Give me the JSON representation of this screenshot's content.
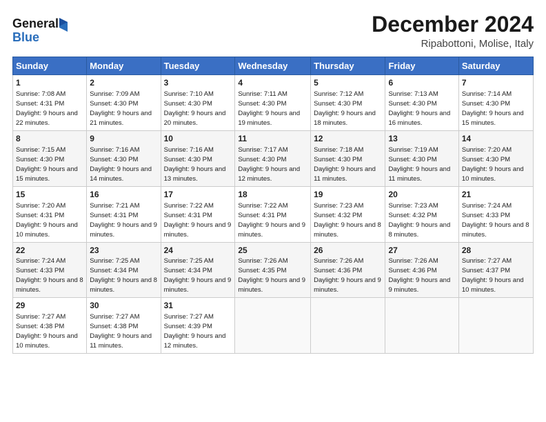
{
  "logo": {
    "line1": "General",
    "line2": "Blue"
  },
  "header": {
    "month": "December 2024",
    "location": "Ripabottoni, Molise, Italy"
  },
  "weekdays": [
    "Sunday",
    "Monday",
    "Tuesday",
    "Wednesday",
    "Thursday",
    "Friday",
    "Saturday"
  ],
  "weeks": [
    [
      {
        "day": "1",
        "sunrise": "7:08 AM",
        "sunset": "4:31 PM",
        "daylight": "9 hours and 22 minutes."
      },
      {
        "day": "2",
        "sunrise": "7:09 AM",
        "sunset": "4:30 PM",
        "daylight": "9 hours and 21 minutes."
      },
      {
        "day": "3",
        "sunrise": "7:10 AM",
        "sunset": "4:30 PM",
        "daylight": "9 hours and 20 minutes."
      },
      {
        "day": "4",
        "sunrise": "7:11 AM",
        "sunset": "4:30 PM",
        "daylight": "9 hours and 19 minutes."
      },
      {
        "day": "5",
        "sunrise": "7:12 AM",
        "sunset": "4:30 PM",
        "daylight": "9 hours and 18 minutes."
      },
      {
        "day": "6",
        "sunrise": "7:13 AM",
        "sunset": "4:30 PM",
        "daylight": "9 hours and 16 minutes."
      },
      {
        "day": "7",
        "sunrise": "7:14 AM",
        "sunset": "4:30 PM",
        "daylight": "9 hours and 15 minutes."
      }
    ],
    [
      {
        "day": "8",
        "sunrise": "7:15 AM",
        "sunset": "4:30 PM",
        "daylight": "9 hours and 15 minutes."
      },
      {
        "day": "9",
        "sunrise": "7:16 AM",
        "sunset": "4:30 PM",
        "daylight": "9 hours and 14 minutes."
      },
      {
        "day": "10",
        "sunrise": "7:16 AM",
        "sunset": "4:30 PM",
        "daylight": "9 hours and 13 minutes."
      },
      {
        "day": "11",
        "sunrise": "7:17 AM",
        "sunset": "4:30 PM",
        "daylight": "9 hours and 12 minutes."
      },
      {
        "day": "12",
        "sunrise": "7:18 AM",
        "sunset": "4:30 PM",
        "daylight": "9 hours and 11 minutes."
      },
      {
        "day": "13",
        "sunrise": "7:19 AM",
        "sunset": "4:30 PM",
        "daylight": "9 hours and 11 minutes."
      },
      {
        "day": "14",
        "sunrise": "7:20 AM",
        "sunset": "4:30 PM",
        "daylight": "9 hours and 10 minutes."
      }
    ],
    [
      {
        "day": "15",
        "sunrise": "7:20 AM",
        "sunset": "4:31 PM",
        "daylight": "9 hours and 10 minutes."
      },
      {
        "day": "16",
        "sunrise": "7:21 AM",
        "sunset": "4:31 PM",
        "daylight": "9 hours and 9 minutes."
      },
      {
        "day": "17",
        "sunrise": "7:22 AM",
        "sunset": "4:31 PM",
        "daylight": "9 hours and 9 minutes."
      },
      {
        "day": "18",
        "sunrise": "7:22 AM",
        "sunset": "4:31 PM",
        "daylight": "9 hours and 9 minutes."
      },
      {
        "day": "19",
        "sunrise": "7:23 AM",
        "sunset": "4:32 PM",
        "daylight": "9 hours and 8 minutes."
      },
      {
        "day": "20",
        "sunrise": "7:23 AM",
        "sunset": "4:32 PM",
        "daylight": "9 hours and 8 minutes."
      },
      {
        "day": "21",
        "sunrise": "7:24 AM",
        "sunset": "4:33 PM",
        "daylight": "9 hours and 8 minutes."
      }
    ],
    [
      {
        "day": "22",
        "sunrise": "7:24 AM",
        "sunset": "4:33 PM",
        "daylight": "9 hours and 8 minutes."
      },
      {
        "day": "23",
        "sunrise": "7:25 AM",
        "sunset": "4:34 PM",
        "daylight": "9 hours and 8 minutes."
      },
      {
        "day": "24",
        "sunrise": "7:25 AM",
        "sunset": "4:34 PM",
        "daylight": "9 hours and 9 minutes."
      },
      {
        "day": "25",
        "sunrise": "7:26 AM",
        "sunset": "4:35 PM",
        "daylight": "9 hours and 9 minutes."
      },
      {
        "day": "26",
        "sunrise": "7:26 AM",
        "sunset": "4:36 PM",
        "daylight": "9 hours and 9 minutes."
      },
      {
        "day": "27",
        "sunrise": "7:26 AM",
        "sunset": "4:36 PM",
        "daylight": "9 hours and 9 minutes."
      },
      {
        "day": "28",
        "sunrise": "7:27 AM",
        "sunset": "4:37 PM",
        "daylight": "9 hours and 10 minutes."
      }
    ],
    [
      {
        "day": "29",
        "sunrise": "7:27 AM",
        "sunset": "4:38 PM",
        "daylight": "9 hours and 10 minutes."
      },
      {
        "day": "30",
        "sunrise": "7:27 AM",
        "sunset": "4:38 PM",
        "daylight": "9 hours and 11 minutes."
      },
      {
        "day": "31",
        "sunrise": "7:27 AM",
        "sunset": "4:39 PM",
        "daylight": "9 hours and 12 minutes."
      },
      null,
      null,
      null,
      null
    ]
  ]
}
